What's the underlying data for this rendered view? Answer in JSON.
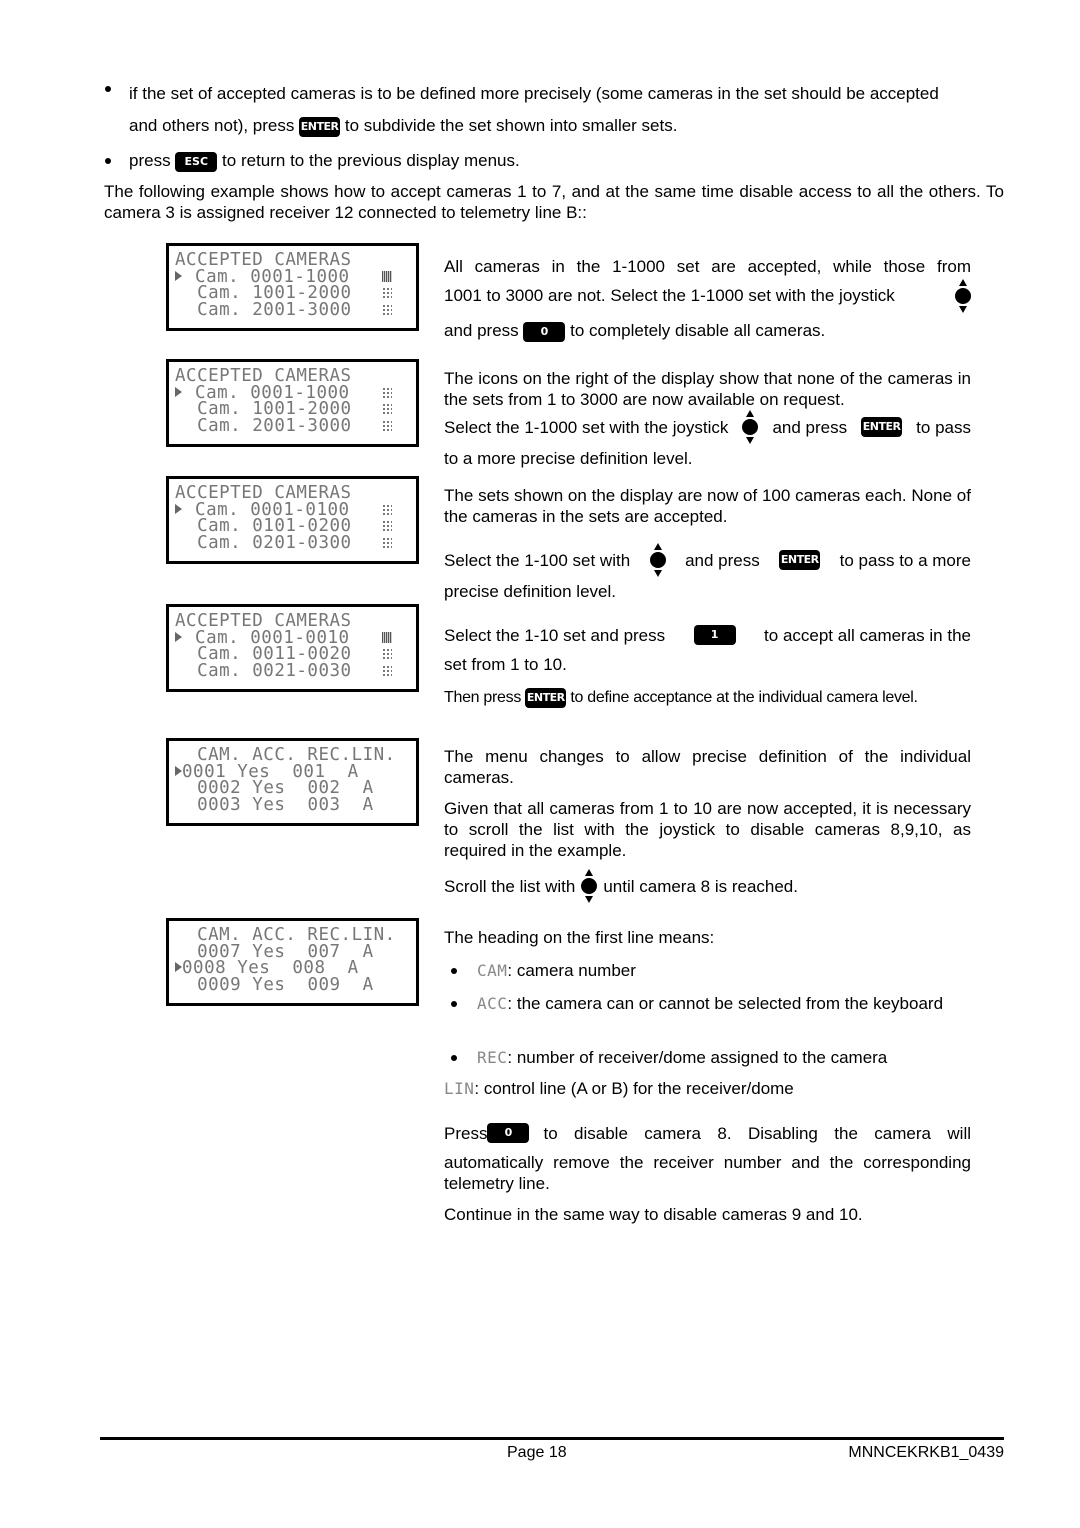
{
  "intro": {
    "bullet1_part1": "if the set of accepted cameras is to be defined more precisely (some cameras in the set should be accepted",
    "bullet1_part2a": "and others not), press",
    "bullet1_part2b": "to subdivide the set shown into smaller sets.",
    "bullet2_a": "press",
    "bullet2_b": "to return to the previous display menus.",
    "example": "The following example shows how to accept cameras 1 to 7, and at the same time disable access to all the others. To camera 3 is assigned receiver 12 connected to telemetry line B::"
  },
  "keys": {
    "enter": "ENTER",
    "esc": "ESC",
    "zero": "0",
    "one": "1"
  },
  "icons": {
    "joystick": "joystick-updown-icon",
    "accepted": "filled-block-icon",
    "not_accepted": "dotted-block-icon"
  },
  "displays": [
    {
      "title": "ACCEPTED CAMERAS",
      "rows": [
        {
          "label": "Cam. 0001-1000",
          "selected": true,
          "status": "full"
        },
        {
          "label": "Cam. 1001-2000",
          "selected": false,
          "status": "empty"
        },
        {
          "label": "Cam. 2001-3000",
          "selected": false,
          "status": "empty"
        }
      ]
    },
    {
      "title": "ACCEPTED CAMERAS",
      "rows": [
        {
          "label": "Cam. 0001-1000",
          "selected": true,
          "status": "empty"
        },
        {
          "label": "Cam. 1001-2000",
          "selected": false,
          "status": "empty"
        },
        {
          "label": "Cam. 2001-3000",
          "selected": false,
          "status": "empty"
        }
      ]
    },
    {
      "title": "ACCEPTED CAMERAS",
      "rows": [
        {
          "label": "Cam. 0001-0100",
          "selected": true,
          "status": "empty"
        },
        {
          "label": "Cam. 0101-0200",
          "selected": false,
          "status": "empty"
        },
        {
          "label": "Cam. 0201-0300",
          "selected": false,
          "status": "empty"
        }
      ]
    },
    {
      "title": "ACCEPTED CAMERAS",
      "rows": [
        {
          "label": "Cam. 0001-0010",
          "selected": true,
          "status": "full"
        },
        {
          "label": "Cam. 0011-0020",
          "selected": false,
          "status": "empty"
        },
        {
          "label": "Cam. 0021-0030",
          "selected": false,
          "status": "empty"
        }
      ]
    },
    {
      "header": "CAM. ACC. REC.LIN.",
      "rows": [
        {
          "cam": "0001",
          "acc": "Yes",
          "rec": "001",
          "lin": "A",
          "selected": true
        },
        {
          "cam": "0002",
          "acc": "Yes",
          "rec": "002",
          "lin": "A",
          "selected": false
        },
        {
          "cam": "0003",
          "acc": "Yes",
          "rec": "003",
          "lin": "A",
          "selected": false
        }
      ]
    },
    {
      "header": "CAM. ACC. REC.LIN.",
      "rows": [
        {
          "cam": "0007",
          "acc": "Yes",
          "rec": "007",
          "lin": "A",
          "selected": false
        },
        {
          "cam": "0008",
          "acc": "Yes",
          "rec": "008",
          "lin": "A",
          "selected": true
        },
        {
          "cam": "0009",
          "acc": "Yes",
          "rec": "009",
          "lin": "A",
          "selected": false
        }
      ]
    }
  ],
  "steps": {
    "s1_a": "All cameras in the 1-1000 set are accepted, while those from",
    "s1_b": "1001 to 3000 are not. Select the 1-1000 set with the joystick",
    "s1_c": "and press",
    "s1_d": "to completely disable all cameras.",
    "s2_a": "The icons on the right of the display show that none of the cameras in the sets from 1 to 3000 are now available on request.",
    "s2_b": "Select the 1-1000 set with the joystick",
    "s2_c": "and press",
    "s2_d": "to pass",
    "s2_e": "to a more precise definition level.",
    "s3_a": "The sets shown on the display are now of 100 cameras each. None of the cameras in the sets are accepted.",
    "s3_b": "Select the 1-100 set with",
    "s3_c": "and press",
    "s3_d": "to pass to a more",
    "s3_e": "precise definition level.",
    "s4_a": "Select the 1-10 set and press",
    "s4_b": "to accept all cameras in the",
    "s4_c": "set from 1 to 10.",
    "s4_d": "Then press",
    "s4_e": "to define acceptance at the individual camera level.",
    "s5_a": "The menu changes to allow precise definition of the individual cameras.",
    "s5_b": "Given that all cameras from 1 to 10 are now accepted, it is necessary to scroll the list with the joystick to disable cameras 8,9,10, as required in the example.",
    "s5_c": "Scroll the list with",
    "s5_d": "until camera 8 is reached.",
    "s6_a": "The heading on the first line means:",
    "legend": [
      {
        "term": "CAM",
        "desc": ": camera number"
      },
      {
        "term": "ACC",
        "desc": ": the camera can or cannot be selected from the keyboard"
      },
      {
        "term": "REC",
        "desc": ": number of receiver/dome assigned to the camera"
      }
    ],
    "lin_term": "LIN",
    "lin_desc": ": control line (A or B) for the receiver/dome",
    "s7_a": "Press",
    "s7_b": "to disable camera 8. Disabling the camera will",
    "s7_c": "automatically remove the receiver number and the corresponding telemetry line.",
    "s8": "Continue in the same way to disable cameras 9 and 10."
  },
  "footer": {
    "page": "Page 18",
    "doc_code": "MNNCEKRKB1_0439"
  }
}
